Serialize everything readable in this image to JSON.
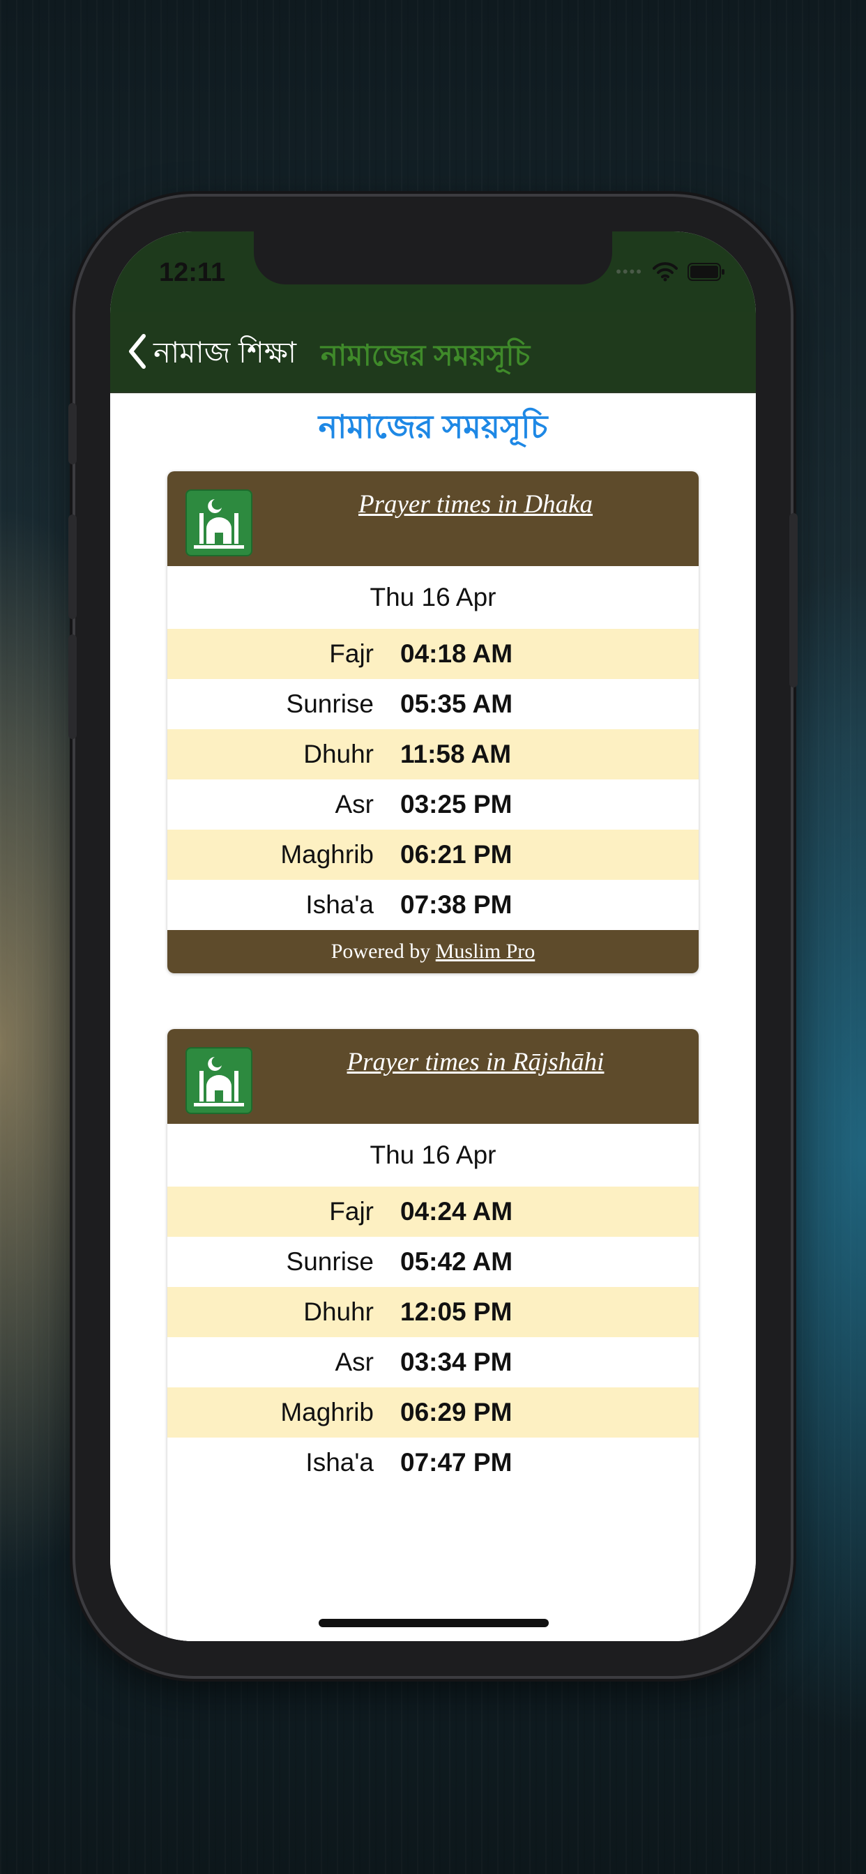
{
  "status_bar": {
    "time": "12:11"
  },
  "nav": {
    "back_label": "নামাজ শিক্ষা",
    "title": "নামাজের সময়সূচি"
  },
  "page": {
    "heading": "নামাজের সময়সূচি"
  },
  "cards": [
    {
      "title": "Prayer times in Dhaka",
      "date": "Thu 16 Apr",
      "times": [
        {
          "name": "Fajr",
          "time": "04:18 AM"
        },
        {
          "name": "Sunrise",
          "time": "05:35 AM"
        },
        {
          "name": "Dhuhr",
          "time": "11:58 AM"
        },
        {
          "name": "Asr",
          "time": "03:25 PM"
        },
        {
          "name": "Maghrib",
          "time": "06:21 PM"
        },
        {
          "name": "Isha'a",
          "time": "07:38 PM"
        }
      ],
      "footer_prefix": "Powered by",
      "footer_link": "Muslim Pro"
    },
    {
      "title": "Prayer times in Rājshāhi",
      "date": "Thu 16 Apr",
      "times": [
        {
          "name": "Fajr",
          "time": "04:24 AM"
        },
        {
          "name": "Sunrise",
          "time": "05:42 AM"
        },
        {
          "name": "Dhuhr",
          "time": "12:05 PM"
        },
        {
          "name": "Asr",
          "time": "03:34 PM"
        },
        {
          "name": "Maghrib",
          "time": "06:29 PM"
        },
        {
          "name": "Isha'a",
          "time": "07:47 PM"
        }
      ]
    }
  ],
  "colors": {
    "nav_background": "#1f3a1c",
    "nav_title": "#3f8a2a",
    "heading": "#1e88e5",
    "card_header": "#5e4b2b",
    "row_shade": "#fdf0c2"
  },
  "icons": [
    "chevron-left-icon",
    "wifi-icon",
    "battery-icon",
    "muslim-pro-logo-icon"
  ]
}
